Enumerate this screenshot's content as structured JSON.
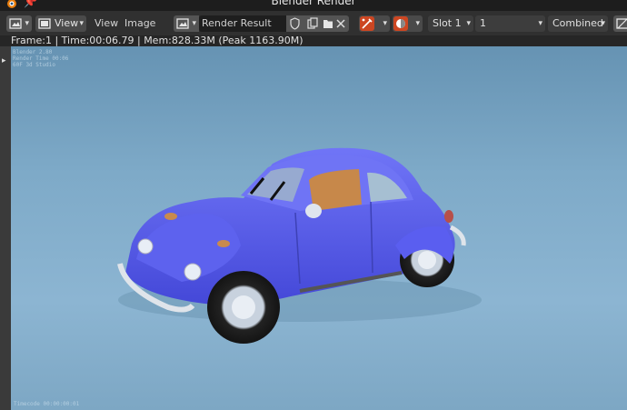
{
  "window": {
    "title": "Blender Render"
  },
  "header": {
    "view_menu": "View",
    "menu_view": "View",
    "menu_image": "Image",
    "image_name": "Render Result",
    "slot": "Slot 1",
    "render_layer": "1 RenderLayer",
    "pass": "Combined"
  },
  "status": {
    "text": "Frame:1 | Time:00:06.79 | Mem:828.33M (Peak 1163.90M)"
  },
  "stamp": {
    "top_lines": [
      "Blender 2.80",
      "Render Time 00:06",
      "60F 3d Studio"
    ],
    "bottom": "Timecode 00:00:00:01"
  },
  "colors": {
    "car_body": "#5a5ef0",
    "window_frame": "#6f74f5",
    "interior": "#c7884a",
    "background_top": "#6693b3",
    "background_bottom": "#8cb5d2",
    "accent_red": "#cc4622"
  },
  "icons": {
    "app": "blender-logo-icon",
    "pin": "pin-icon",
    "editor_type": "image-editor-icon",
    "browse": "image-browse-icon",
    "fake_user": "shield-icon",
    "new": "duplicate-icon",
    "open": "folder-icon",
    "unlink": "close-icon",
    "sampling": "sample-tool-icon",
    "display_channels": "color-channels-icon"
  }
}
